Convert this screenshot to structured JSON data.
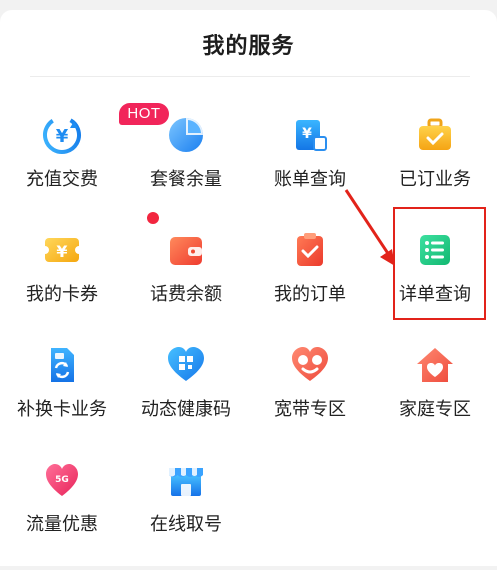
{
  "page": {
    "title": "我的服务"
  },
  "badges": {
    "hot": "HOT"
  },
  "services": [
    {
      "label": "充值交费",
      "icon": "yuan-circle-icon"
    },
    {
      "label": "套餐余量",
      "icon": "pie-chart-icon"
    },
    {
      "label": "账单查询",
      "icon": "bill-yuan-icon"
    },
    {
      "label": "已订业务",
      "icon": "briefcase-check-icon"
    },
    {
      "label": "我的卡券",
      "icon": "coupon-ticket-icon"
    },
    {
      "label": "话费余额",
      "icon": "wallet-icon"
    },
    {
      "label": "我的订单",
      "icon": "clipboard-check-icon"
    },
    {
      "label": "详单查询",
      "icon": "list-detail-icon"
    },
    {
      "label": "补换卡业务",
      "icon": "sim-card-swap-icon"
    },
    {
      "label": "动态健康码",
      "icon": "heart-qr-icon"
    },
    {
      "label": "宽带专区",
      "icon": "broadband-heart-icon"
    },
    {
      "label": "家庭专区",
      "icon": "home-heart-icon"
    },
    {
      "label": "流量优惠",
      "icon": "data-discount-heart-icon"
    },
    {
      "label": "在线取号",
      "icon": "online-store-icon"
    }
  ],
  "colors": {
    "highlight": "#e2231a",
    "hot_badge": "#f1255a"
  }
}
